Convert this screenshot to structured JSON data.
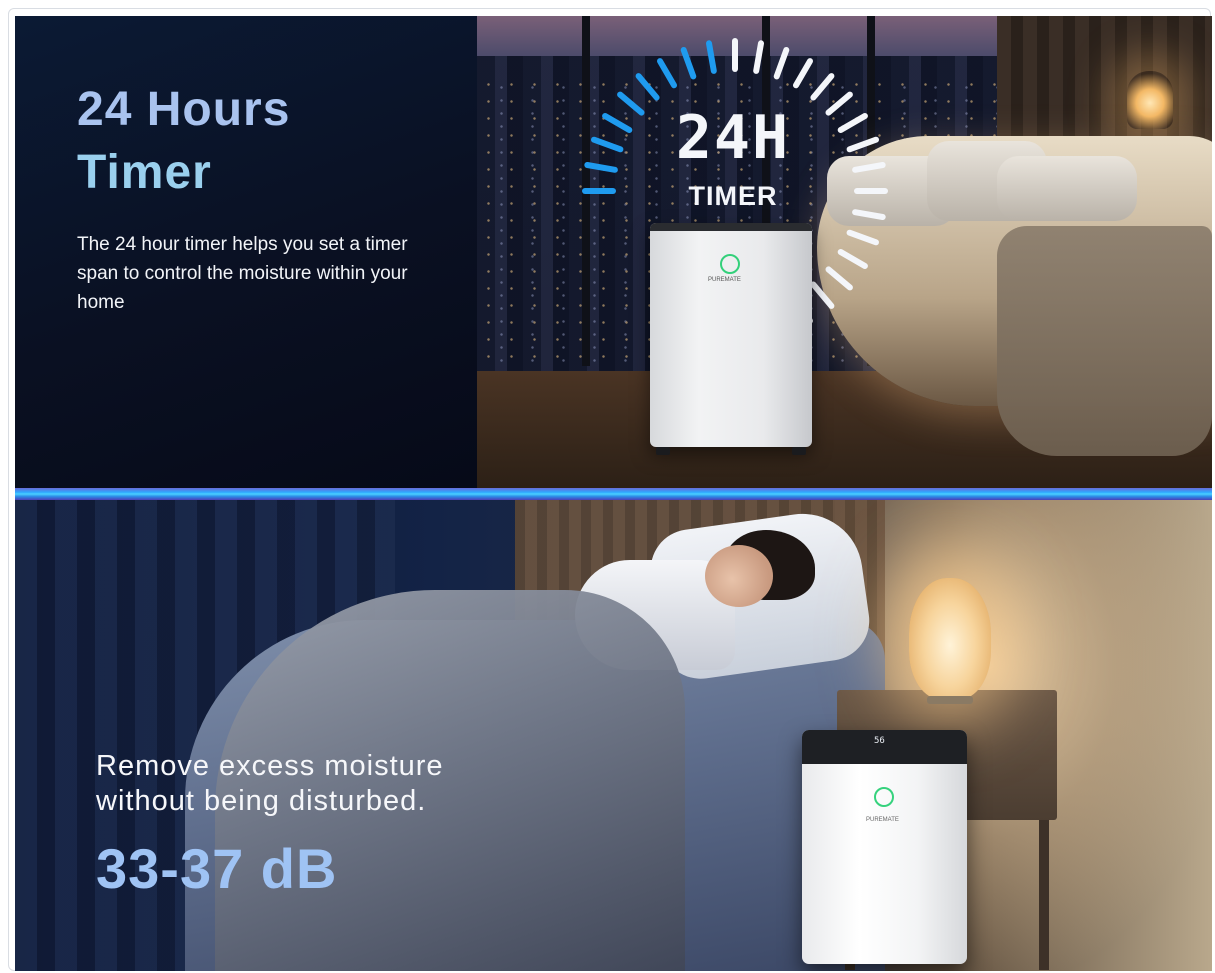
{
  "top_panel": {
    "title_line1": "24 Hours",
    "title_line2": "Timer",
    "description": "The 24 hour timer helps you set a timer span to control the moisture within your home",
    "timer_digits": "24H",
    "timer_label": "TIMER",
    "brand_label": "PUREMATE",
    "dial_colors": {
      "blue": "#1f9bef",
      "white": "#f4f6fa"
    }
  },
  "bottom_panel": {
    "tagline": "Remove excess moisture without being disturbed.",
    "noise_level": "33-37 dB",
    "display_value": "56",
    "brand_label": "PUREMATE"
  },
  "colors": {
    "title_blue": "#a9c3ef",
    "title_cyan": "#9ad0ee",
    "db_blue": "#9fc3f4",
    "divider_accent": "#2fa8ff",
    "status_ring_green": "#33d07a"
  },
  "icons": [
    "timer-dial-icon",
    "power-ring-icon",
    "brand-logo-icon"
  ]
}
